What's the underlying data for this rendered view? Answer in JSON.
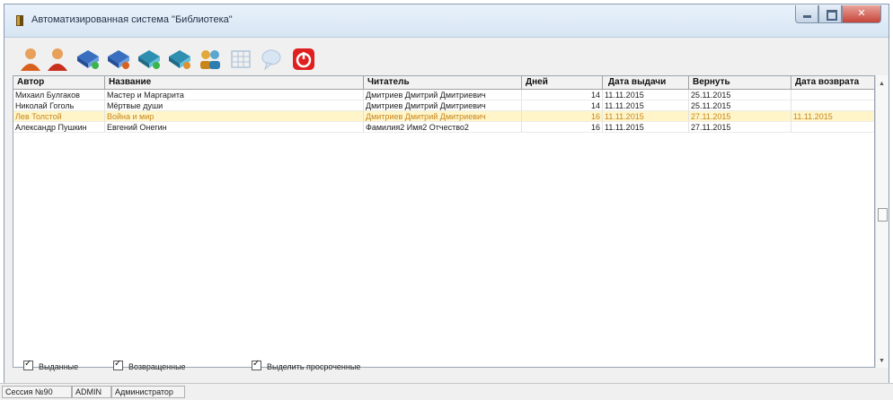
{
  "window": {
    "title": "Автоматизированная система \"Библиотека\"",
    "colors": {
      "title_bg": "#dbe7f4",
      "close": "#c6453a",
      "overdue_row": "#fff5c8",
      "overdue_text": "#c8851b"
    }
  },
  "toolbar": {
    "buttons": [
      {
        "icon": "add-reader-icon"
      },
      {
        "icon": "remove-reader-icon"
      },
      {
        "icon": "add-book-icon"
      },
      {
        "icon": "remove-book-icon"
      },
      {
        "icon": "issue-book-icon"
      },
      {
        "icon": "return-book-icon"
      },
      {
        "icon": "readers-icon"
      },
      {
        "icon": "table-icon"
      },
      {
        "icon": "chat-icon"
      },
      {
        "icon": "power-icon"
      }
    ]
  },
  "table": {
    "columns": [
      "Автор",
      "Название",
      "Читатель",
      "Дней",
      "Дата выдачи",
      "Вернуть",
      "Дата возврата"
    ],
    "rows": [
      {
        "author": "Михаил Булгаков",
        "title": "Мастер и Маргарита",
        "reader": "Дмитриев Дмитрий Дмитриевич",
        "days": "14",
        "issued": "11.11.2015",
        "due": "25.11.2015",
        "returned": "",
        "highlight": false
      },
      {
        "author": "Николай Гоголь",
        "title": "Мёртвые души",
        "reader": "Дмитриев Дмитрий Дмитриевич",
        "days": "14",
        "issued": "11.11.2015",
        "due": "25.11.2015",
        "returned": "",
        "highlight": false
      },
      {
        "author": "Лев Толстой",
        "title": "Война и мир",
        "reader": "Дмитриев Дмитрий Дмитриевич",
        "days": "16",
        "issued": "11.11.2015",
        "due": "27.11.2015",
        "returned": "11.11.2015",
        "highlight": true
      },
      {
        "author": "Александр Пушкин",
        "title": "Евгений Онегин",
        "reader": "Фамилия2 Имя2 Отчество2",
        "days": "16",
        "issued": "11.11.2015",
        "due": "27.11.2015",
        "returned": "",
        "highlight": false
      }
    ]
  },
  "filters": {
    "issued_label": "Выданные",
    "returned_label": "Возвращенные",
    "overdue_label": "Выделить просроченные"
  },
  "statusbar": {
    "session": "Сессия №90",
    "user": "ADMIN",
    "role": "Администратор"
  }
}
